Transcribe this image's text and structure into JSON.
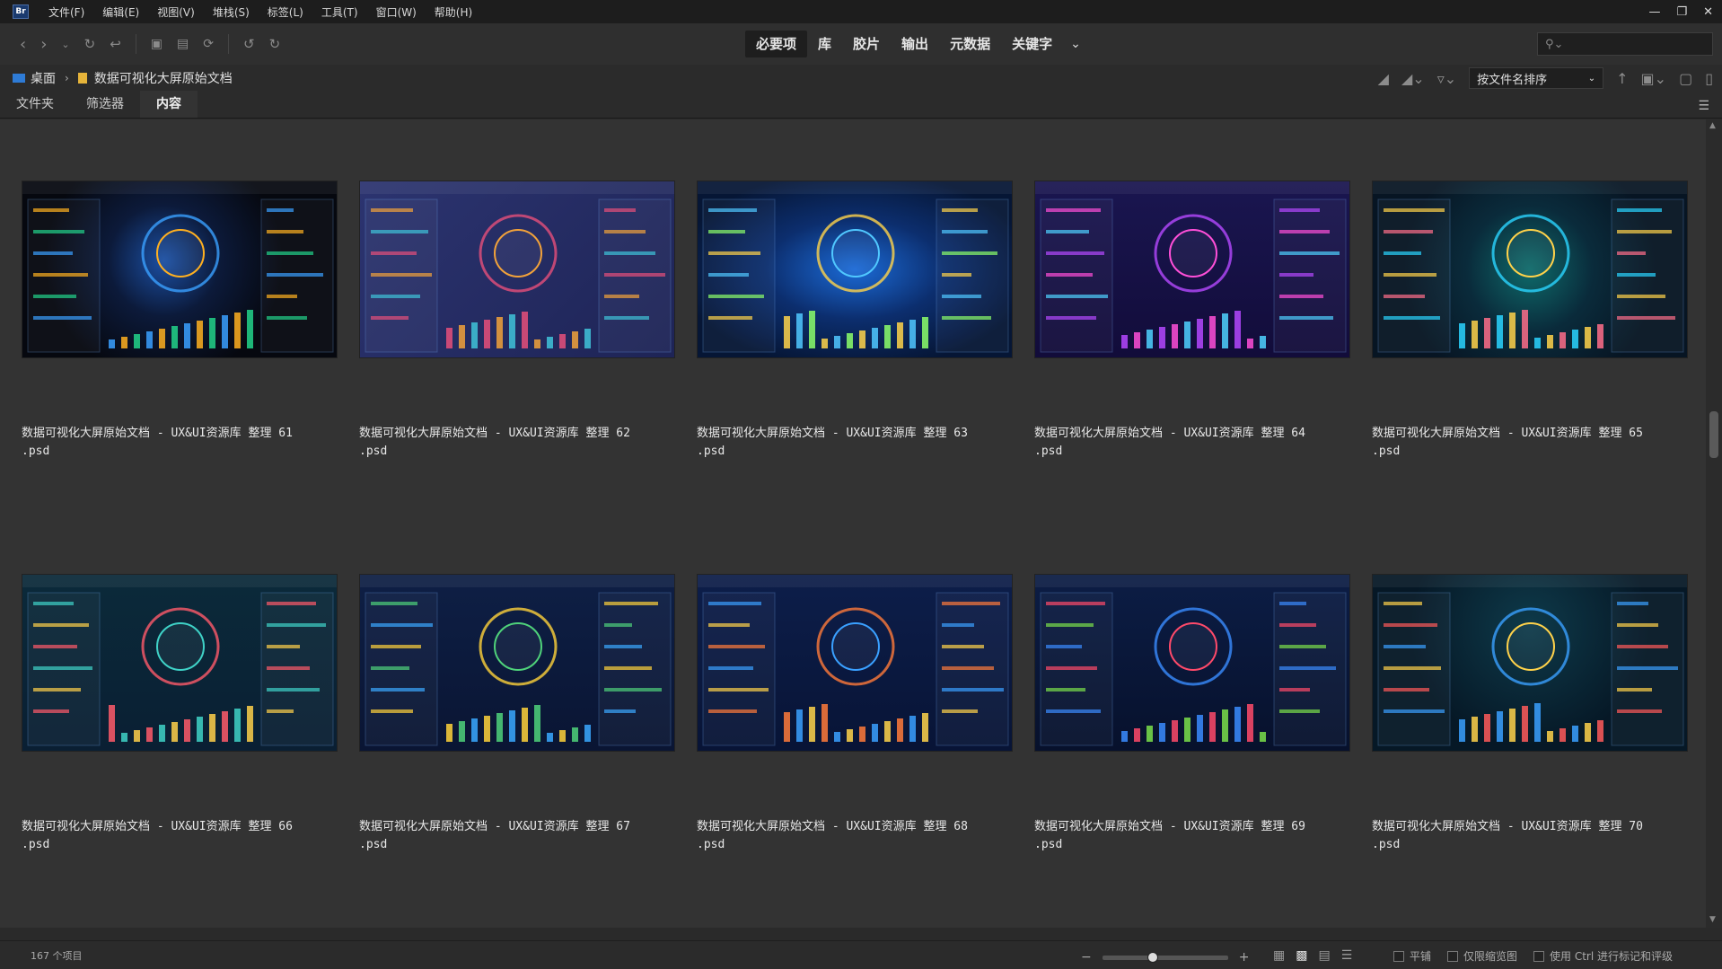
{
  "menubar": {
    "logo": "Br",
    "items": [
      "文件(F)",
      "编辑(E)",
      "视图(V)",
      "堆栈(S)",
      "标签(L)",
      "工具(T)",
      "窗口(W)",
      "帮助(H)"
    ]
  },
  "workspaces": {
    "items": [
      "必要项",
      "库",
      "胶片",
      "输出",
      "元数据",
      "关键字"
    ],
    "active": "必要项"
  },
  "path": {
    "items": [
      "桌面",
      "数据可视化大屏原始文档"
    ]
  },
  "sort": {
    "value": "按文件名排序"
  },
  "tabs": {
    "items": [
      "文件夹",
      "筛选器",
      "内容"
    ],
    "active": "内容"
  },
  "files": [
    {
      "name": "数据可视化大屏原始文档 - UX&UI资源库 整理 61",
      "ext": ".psd",
      "theme": "globe-black"
    },
    {
      "name": "数据可视化大屏原始文档 - UX&UI资源库 整理 62",
      "ext": ".psd",
      "theme": "waves-indigo"
    },
    {
      "name": "数据可视化大屏原始文档 - UX&UI资源库 整理 63",
      "ext": ".psd",
      "theme": "map-blue"
    },
    {
      "name": "数据可视化大屏原始文档 - UX&UI资源库 整理 64",
      "ext": ".psd",
      "theme": "purple-area"
    },
    {
      "name": "数据可视化大屏原始文档 - UX&UI资源库 整理 65",
      "ext": ".psd",
      "theme": "teal-globe"
    },
    {
      "name": "数据可视化大屏原始文档 - UX&UI资源库 整理 66",
      "ext": ".psd",
      "theme": "radar-teal"
    },
    {
      "name": "数据可视化大屏原始文档 - UX&UI资源库 整理 67",
      "ext": ".psd",
      "theme": "pie-navy"
    },
    {
      "name": "数据可视化大屏原始文档 - UX&UI资源库 整理 68",
      "ext": ".psd",
      "theme": "rings-navy"
    },
    {
      "name": "数据可视化大屏原始文档 - UX&UI资源库 整理 69",
      "ext": ".psd",
      "theme": "bars-blue"
    },
    {
      "name": "数据可视化大屏原始文档 - UX&UI资源库 整理 70",
      "ext": ".psd",
      "theme": "dark-bars"
    }
  ],
  "status": {
    "count": "167 个项目",
    "options": [
      "平铺",
      "仅限缩览图",
      "使用 Ctrl 进行标记和评级"
    ],
    "zoom_level": 0.4
  },
  "icons": {
    "menubar": [
      "minimize-icon",
      "restore-icon",
      "close-icon"
    ],
    "toolbar": [
      "back-icon",
      "forward-icon",
      "recent-folders-icon",
      "reveal-icon",
      "camera-icon",
      "batch-icon",
      "refresh-icon",
      "rotate-left-icon",
      "rotate-right-icon"
    ],
    "pathbar": [
      "quality-icon",
      "rating-filter-icon",
      "filter-icon",
      "sort-direction-icon",
      "open-recent-icon",
      "new-folder-icon",
      "delete-icon"
    ],
    "search": "search-icon",
    "views": [
      "grid-view-icon",
      "thumb-view-icon",
      "detail-view-icon",
      "list-view-icon"
    ]
  },
  "colors": {
    "accent": "#2e7bd6",
    "folder": "#e6b43a",
    "background": "#333333"
  }
}
